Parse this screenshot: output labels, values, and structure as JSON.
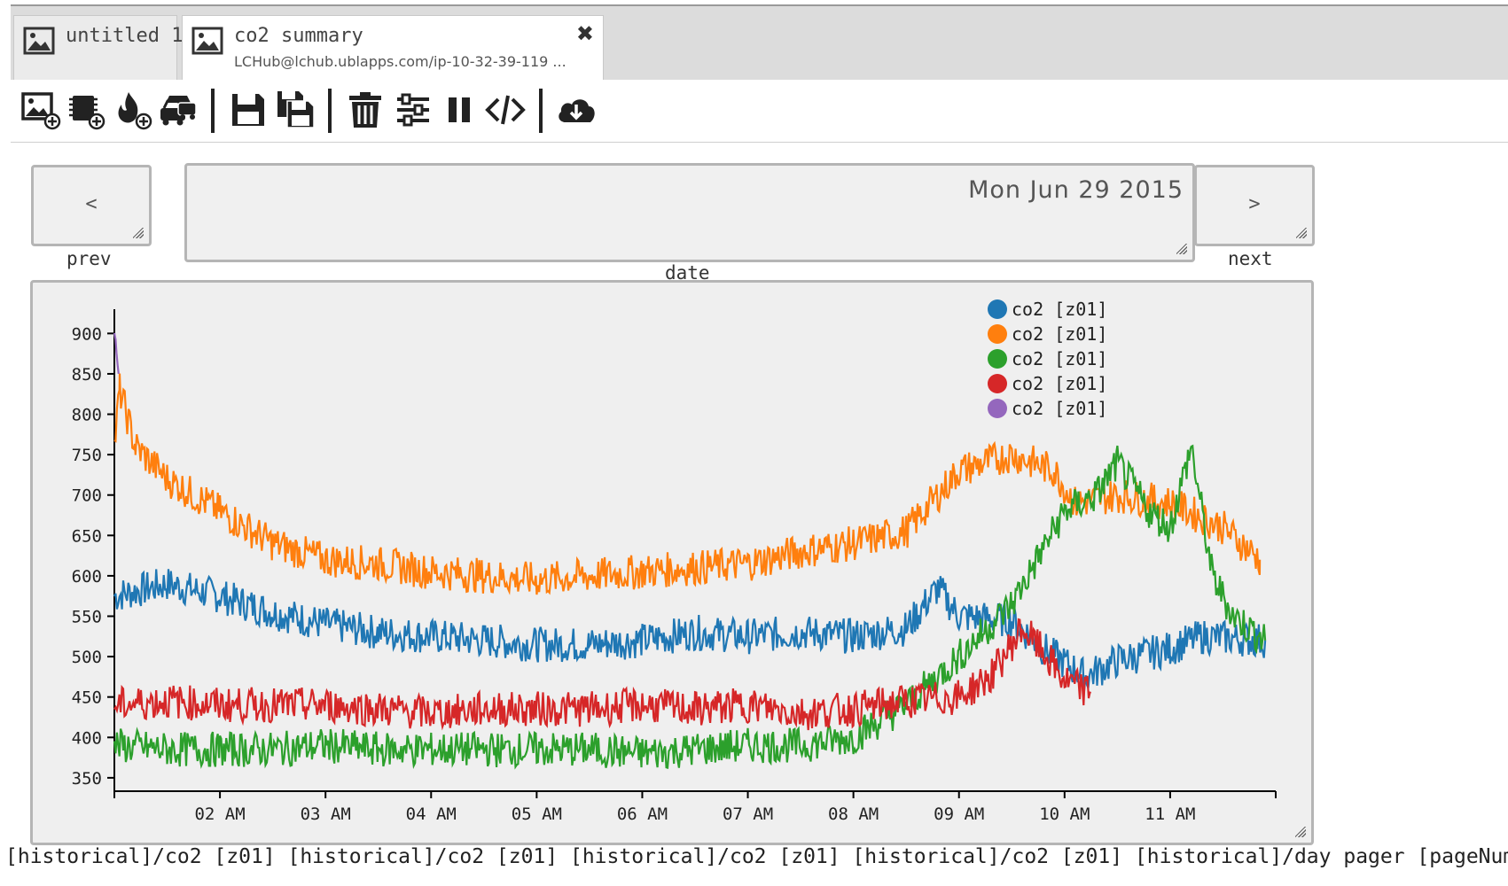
{
  "tabs": [
    {
      "title": "untitled 1",
      "icon": "image-icon"
    },
    {
      "title": "co2 summary",
      "subtitle": "LCHub@lchub.ublapps.com/ip-10-32-39-119 ...",
      "icon": "image-icon",
      "close": "✖"
    }
  ],
  "toolbar": {
    "icons": [
      "add-image-icon",
      "add-device-icon",
      "add-fire-icon",
      "traffic-icon",
      "save-icon",
      "save-all-icon",
      "trash-icon",
      "sliders-icon",
      "pause-icon",
      "code-icon",
      "cloud-download-icon"
    ]
  },
  "pager": {
    "prev_label": "<",
    "prev_caption": "prev",
    "next_label": ">",
    "next_caption": "next",
    "date_value": "Mon Jun 29 2015",
    "date_caption": "date"
  },
  "footer_text": "[historical]/co2 [z01] [historical]/co2 [z01] [historical]/co2 [z01] [historical]/co2 [z01] [historical]/day pager [pageNum]",
  "chart_data": {
    "type": "line",
    "ylim": [
      340,
      930
    ],
    "yticks": [
      350,
      400,
      450,
      500,
      550,
      600,
      650,
      700,
      750,
      800,
      850,
      900
    ],
    "xlim": [
      "01:00",
      "12:00"
    ],
    "xticks": [
      "02 AM",
      "03 AM",
      "04 AM",
      "05 AM",
      "06 AM",
      "07 AM",
      "08 AM",
      "09 AM",
      "10 AM",
      "11 AM"
    ],
    "legend_position": "top-right",
    "grid": false,
    "series": [
      {
        "name": "co2 [z01]",
        "color": "#1f77b4",
        "end": 11.9,
        "points": [
          [
            1.0,
            575
          ],
          [
            1.5,
            590
          ],
          [
            2.0,
            575
          ],
          [
            2.5,
            555
          ],
          [
            3.0,
            540
          ],
          [
            3.5,
            530
          ],
          [
            4.0,
            525
          ],
          [
            4.5,
            520
          ],
          [
            5.0,
            515
          ],
          [
            5.5,
            515
          ],
          [
            6.0,
            520
          ],
          [
            6.5,
            530
          ],
          [
            7.0,
            525
          ],
          [
            7.5,
            530
          ],
          [
            8.0,
            525
          ],
          [
            8.5,
            535
          ],
          [
            8.8,
            585
          ],
          [
            9.0,
            550
          ],
          [
            9.5,
            545
          ],
          [
            9.8,
            510
          ],
          [
            10.2,
            475
          ],
          [
            10.5,
            495
          ],
          [
            11.0,
            510
          ],
          [
            11.3,
            525
          ],
          [
            11.9,
            520
          ]
        ]
      },
      {
        "name": "co2 [z01]",
        "color": "#ff7f0e",
        "end": 11.85,
        "points": [
          [
            1.0,
            760
          ],
          [
            1.05,
            830
          ],
          [
            1.2,
            760
          ],
          [
            1.5,
            720
          ],
          [
            2.0,
            680
          ],
          [
            2.5,
            640
          ],
          [
            3.0,
            620
          ],
          [
            3.5,
            615
          ],
          [
            4.0,
            605
          ],
          [
            4.5,
            600
          ],
          [
            5.0,
            595
          ],
          [
            5.5,
            600
          ],
          [
            6.0,
            605
          ],
          [
            6.5,
            610
          ],
          [
            7.0,
            615
          ],
          [
            7.5,
            630
          ],
          [
            8.0,
            640
          ],
          [
            8.5,
            655
          ],
          [
            9.0,
            730
          ],
          [
            9.5,
            750
          ],
          [
            9.9,
            730
          ],
          [
            10.1,
            690
          ],
          [
            10.5,
            700
          ],
          [
            11.0,
            690
          ],
          [
            11.5,
            660
          ],
          [
            11.85,
            620
          ]
        ]
      },
      {
        "name": "co2 [z01]",
        "color": "#2ca02c",
        "end": 11.9,
        "points": [
          [
            1.0,
            390
          ],
          [
            1.5,
            385
          ],
          [
            2.0,
            385
          ],
          [
            2.5,
            385
          ],
          [
            3.0,
            390
          ],
          [
            3.5,
            385
          ],
          [
            4.0,
            385
          ],
          [
            4.5,
            385
          ],
          [
            5.0,
            385
          ],
          [
            5.5,
            385
          ],
          [
            6.0,
            380
          ],
          [
            6.5,
            385
          ],
          [
            7.0,
            390
          ],
          [
            7.5,
            390
          ],
          [
            8.0,
            400
          ],
          [
            8.5,
            440
          ],
          [
            9.0,
            500
          ],
          [
            9.5,
            565
          ],
          [
            10.0,
            680
          ],
          [
            10.3,
            700
          ],
          [
            10.5,
            740
          ],
          [
            10.8,
            680
          ],
          [
            11.0,
            660
          ],
          [
            11.2,
            760
          ],
          [
            11.4,
            600
          ],
          [
            11.6,
            550
          ],
          [
            11.9,
            520
          ]
        ]
      },
      {
        "name": "co2 [z01]",
        "color": "#d62728",
        "end": 10.25,
        "points": [
          [
            1.0,
            440
          ],
          [
            1.5,
            445
          ],
          [
            2.0,
            440
          ],
          [
            2.5,
            440
          ],
          [
            3.0,
            440
          ],
          [
            3.5,
            435
          ],
          [
            4.0,
            430
          ],
          [
            4.5,
            435
          ],
          [
            5.0,
            435
          ],
          [
            5.5,
            435
          ],
          [
            6.0,
            440
          ],
          [
            6.5,
            435
          ],
          [
            7.0,
            440
          ],
          [
            7.5,
            430
          ],
          [
            8.0,
            435
          ],
          [
            8.5,
            445
          ],
          [
            9.0,
            450
          ],
          [
            9.3,
            475
          ],
          [
            9.6,
            535
          ],
          [
            9.8,
            505
          ],
          [
            10.0,
            470
          ],
          [
            10.25,
            455
          ]
        ]
      },
      {
        "name": "co2 [z01]",
        "color": "#9467bd",
        "end": 1.05,
        "points": [
          [
            1.0,
            905
          ],
          [
            1.02,
            880
          ],
          [
            1.04,
            850
          ]
        ]
      }
    ]
  }
}
